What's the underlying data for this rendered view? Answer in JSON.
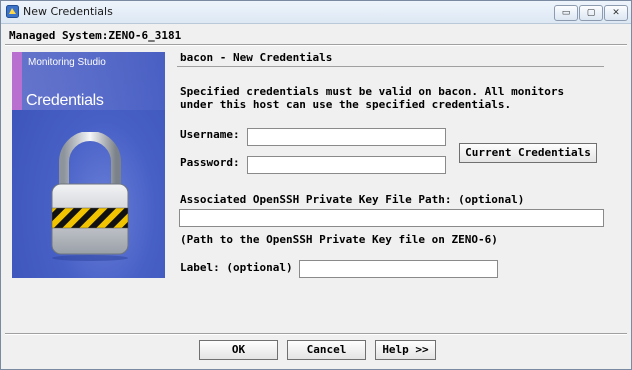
{
  "window": {
    "title": "New Credentials",
    "controls": {
      "minimize": "▭",
      "maximize": "▢",
      "close": "✕"
    }
  },
  "managed_system": "Managed System:ZENO-6_3181",
  "banner": {
    "product": "Monitoring Studio",
    "title": "Credentials",
    "icon": "padlock-icon"
  },
  "form": {
    "heading": "bacon - New Credentials",
    "description": "Specified credentials must be valid on bacon. All monitors\nunder this host can use the specified credentials.",
    "username_label": "Username:",
    "username_value": "",
    "password_label": "Password:",
    "password_value": "",
    "current_credentials_button": "Current Credentials",
    "key_path_label": "Associated OpenSSH Private Key File Path: (optional)",
    "key_path_value": "",
    "key_path_hint": "(Path to the OpenSSH Private Key file on ZENO-6)",
    "label_label": "Label: (optional)",
    "label_value": ""
  },
  "buttons": {
    "ok": "OK",
    "cancel": "Cancel",
    "help": "Help >>"
  },
  "colors": {
    "banner": "#4760c6",
    "accent": "#b86fd0",
    "lock_stripe_yellow": "#f2c400",
    "lock_stripe_black": "#111111"
  }
}
